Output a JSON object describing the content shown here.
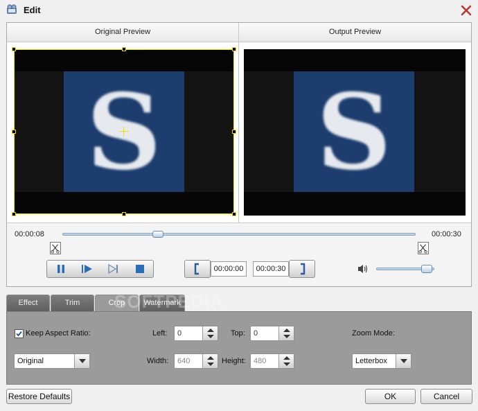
{
  "window": {
    "title": "Edit"
  },
  "preview": {
    "original_label": "Original Preview",
    "output_label": "Output Preview",
    "video_letter": "S"
  },
  "playback": {
    "current_time": "00:00:08",
    "total_time": "00:00:30",
    "timeline_fraction": 0.27,
    "clip_start": "00:00:00",
    "clip_end": "00:00:30",
    "volume_fraction": 0.95
  },
  "tabs": [
    {
      "label": "Effect",
      "active": false
    },
    {
      "label": "Trim",
      "active": false
    },
    {
      "label": "Crop",
      "active": true
    },
    {
      "label": "Watermark",
      "active": false
    }
  ],
  "watermark_text": "SOFTPEDIA",
  "crop": {
    "keep_aspect_label": "Keep Aspect Ratio:",
    "keep_aspect_checked": true,
    "aspect_value": "Original",
    "left_label": "Left:",
    "left_value": "0",
    "top_label": "Top:",
    "top_value": "0",
    "width_label": "Width:",
    "width_value": "640",
    "height_label": "Height:",
    "height_value": "480",
    "zoom_label": "Zoom Mode:",
    "zoom_value": "Letterbox"
  },
  "buttons": {
    "restore": "Restore Defaults",
    "ok": "OK",
    "cancel": "Cancel"
  },
  "colors": {
    "close": "#c0392b",
    "crop_frame": "#f0e000",
    "video_bg": "#1c3d6e",
    "play_blue": "#2a6fb6"
  }
}
